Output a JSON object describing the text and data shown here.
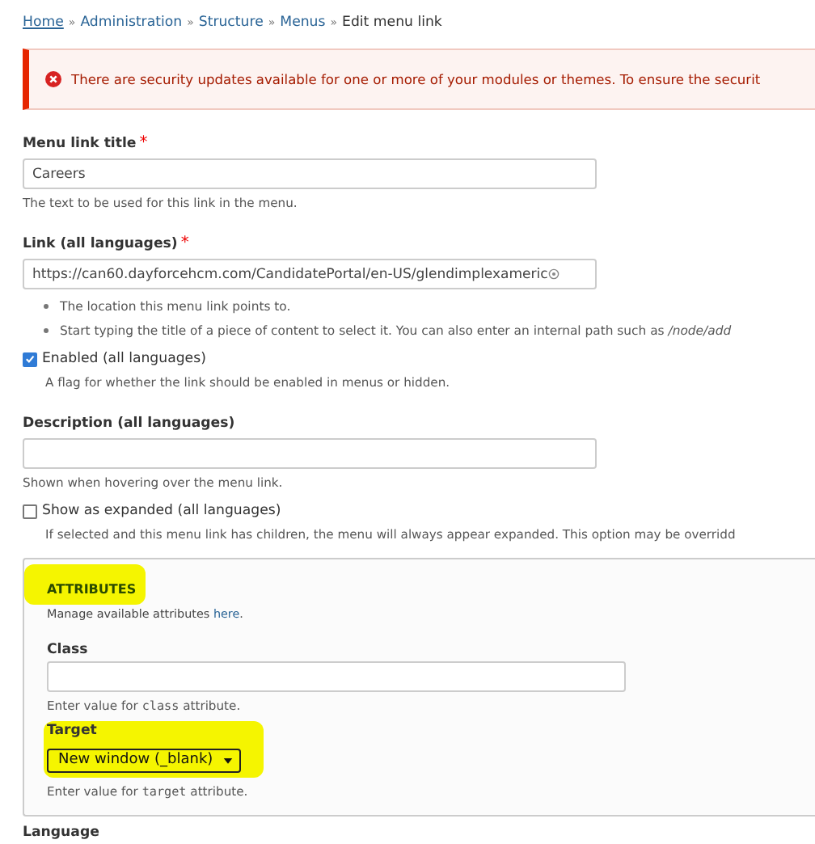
{
  "breadcrumb": [
    {
      "label": "Home",
      "current": false
    },
    {
      "label": "Administration",
      "current": false
    },
    {
      "label": "Structure",
      "current": false
    },
    {
      "label": "Menus",
      "current": false
    },
    {
      "label": "Edit menu link",
      "current": true
    }
  ],
  "breadcrumb_separator": "»",
  "message": {
    "kind": "error",
    "text": "There are security updates available for one or more of your modules or themes. To ensure the securit"
  },
  "fields": [
    {
      "kind": "text",
      "label": "Menu link title",
      "required_mark": "*",
      "value": "Careers",
      "description": "The text to be used for this link in the menu."
    },
    {
      "kind": "link",
      "label": "Link (all languages)",
      "required_mark": "*",
      "value": "https://can60.dayforcehcm.com/CandidatePortal/en-US/glendimplexameric",
      "bullets": [
        "The location this menu link points to.",
        "Start typing the title of a piece of content to select it. You can also enter an internal path such as */node/add*"
      ]
    },
    {
      "kind": "checkbox",
      "label": "Enabled (all languages)",
      "checked": true,
      "description": "A flag for whether the link should be enabled in menus or hidden."
    },
    {
      "kind": "text",
      "label": "Description (all languages)",
      "description": "Shown when hovering over the menu link."
    },
    {
      "kind": "checkbox",
      "label": "Show as expanded (all languages)",
      "checked": false,
      "description": "If selected and this menu link has children, the menu will always appear expanded. This option may be overridd"
    }
  ],
  "attributes": {
    "title": "ATTRIBUTES",
    "highlighted": true,
    "manage_text": "Manage available attributes ",
    "manage_link": "here",
    "manage_end": ".",
    "fields": [
      {
        "kind": "text",
        "label": "Class",
        "highlighted": false,
        "description_parts": [
          "Enter value for ",
          "class",
          " attribute."
        ]
      },
      {
        "kind": "select",
        "label": "Target",
        "value": "New window (_blank)",
        "highlighted": true,
        "description_parts": [
          "Enter value for ",
          "target",
          " attribute."
        ]
      }
    ]
  },
  "next_label": "Language"
}
